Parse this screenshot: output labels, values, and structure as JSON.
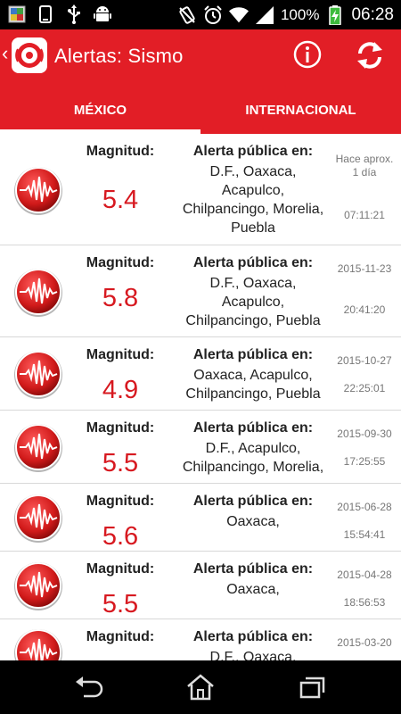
{
  "status_bar": {
    "battery": "100%",
    "time": "06:28",
    "icons": [
      "notification-image-icon",
      "phone-icon",
      "usb-icon",
      "android-icon",
      "vibrate-off-icon",
      "alarm-icon",
      "wifi-icon",
      "signal-icon",
      "battery-charging-icon"
    ]
  },
  "app_bar": {
    "title": "Alertas: Sismo",
    "back_glyph": "‹",
    "colors": {
      "primary": "#e21e26",
      "magnitude": "#d71920"
    }
  },
  "tabs": [
    {
      "label": "MÉXICO",
      "active": true
    },
    {
      "label": "INTERNACIONAL",
      "active": false
    }
  ],
  "list": {
    "magnitude_label": "Magnitud:",
    "alert_label": "Alerta pública en:",
    "items": [
      {
        "magnitude": "5.4",
        "places": [
          "D.F., Oaxaca,",
          "Acapulco,",
          "Chilpancingo, Morelia,",
          "Puebla"
        ],
        "date": "Hace aprox. 1 día",
        "time": "07:11:21"
      },
      {
        "magnitude": "5.8",
        "places": [
          "D.F., Oaxaca,",
          "Acapulco,",
          "Chilpancingo, Puebla"
        ],
        "date": "2015-11-23",
        "time": "20:41:20"
      },
      {
        "magnitude": "4.9",
        "places": [
          "Oaxaca, Acapulco,",
          "Chilpancingo, Puebla"
        ],
        "date": "2015-10-27",
        "time": "22:25:01"
      },
      {
        "magnitude": "5.5",
        "places": [
          "D.F., Acapulco,",
          "Chilpancingo, Morelia,"
        ],
        "date": "2015-09-30",
        "time": "17:25:55"
      },
      {
        "magnitude": "5.6",
        "places": [
          "Oaxaca,"
        ],
        "date": "2015-06-28",
        "time": "15:54:41"
      },
      {
        "magnitude": "5.5",
        "places": [
          "Oaxaca,"
        ],
        "date": "2015-04-28",
        "time": "18:56:53"
      },
      {
        "magnitude": "",
        "places": [
          "D.F., Oaxaca,"
        ],
        "date": "2015-03-20",
        "time": ""
      }
    ]
  },
  "nav_bar": {
    "buttons": [
      "back-icon",
      "home-icon",
      "recents-icon"
    ]
  }
}
